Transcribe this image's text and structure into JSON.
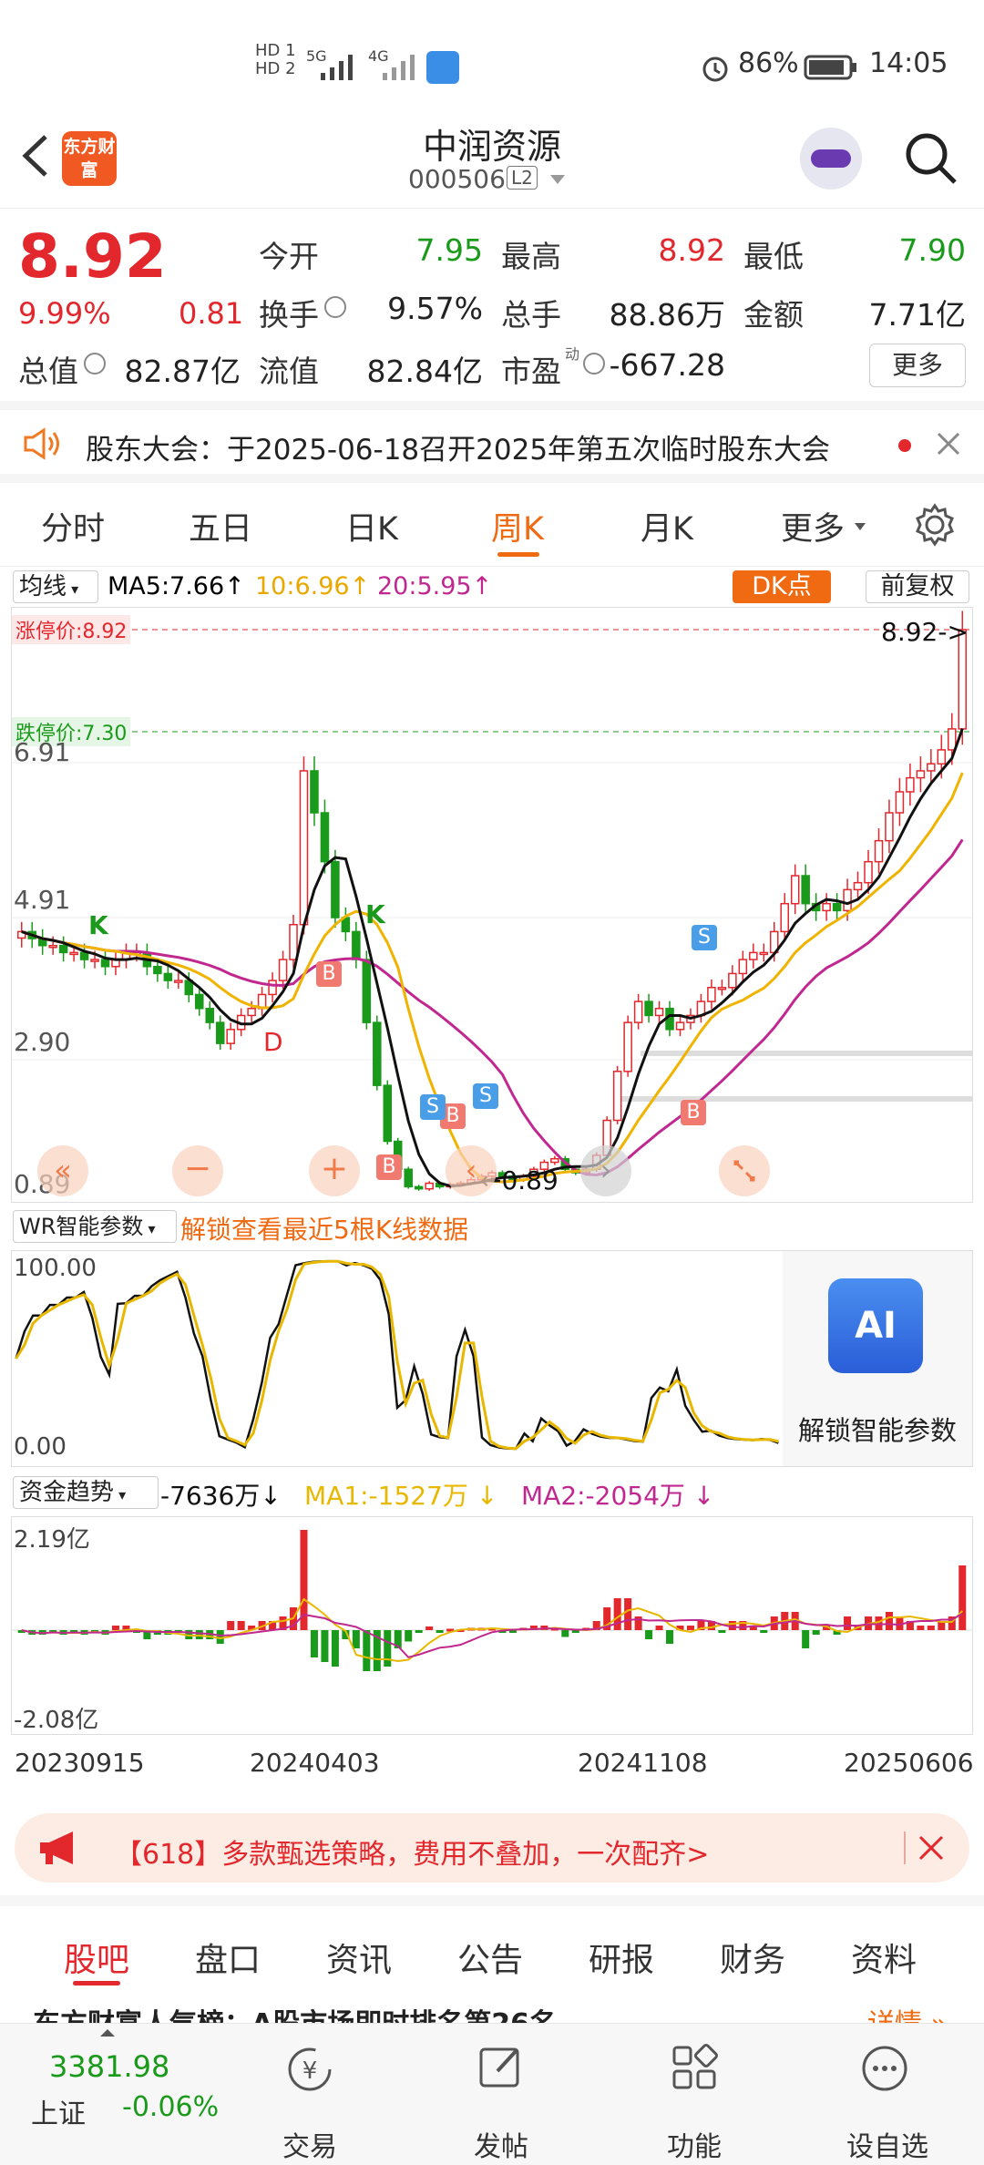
{
  "status": {
    "hd1": "HD 1",
    "hd2": "HD 2",
    "net1": "5G",
    "net2": "4G",
    "battery": "86%",
    "time": "14:05"
  },
  "nav": {
    "logo": "东方财富",
    "title": "中润资源",
    "code": "000506",
    "level": "L2"
  },
  "quote": {
    "price": "8.92",
    "pct": "9.99%",
    "chg": "0.81",
    "l_open": "今开",
    "v_open": "7.95",
    "l_high": "最高",
    "v_high": "8.92",
    "l_low": "最低",
    "v_low": "7.90",
    "l_turn": "换手",
    "v_turn": "9.57%",
    "l_vol": "总手",
    "v_vol": "88.86万",
    "l_amt": "金额",
    "v_amt": "7.71亿",
    "l_mcap": "总值",
    "v_mcap": "82.87亿",
    "l_float": "流值",
    "v_float": "82.84亿",
    "l_pe": "市盈",
    "pe_sup": "动",
    "v_pe": "-667.28",
    "more": "更多"
  },
  "notice": {
    "text": "股东大会：于2025-06-18召开2025年第五次临时股东大会"
  },
  "tabs": [
    "分时",
    "五日",
    "日K",
    "周K",
    "月K",
    "更多"
  ],
  "indicator": {
    "type": "均线",
    "ma5": "MA5:7.66",
    "ma10": "10:6.96",
    "ma20": "20:5.95",
    "dk": "DK点",
    "adjust": "前复权"
  },
  "chart": {
    "limit_up": "涨停价:8.92",
    "limit_down": "跌停价:7.30",
    "y_top": "8.92",
    "y_1": "6.91",
    "y_2": "4.91",
    "y_3": "2.90",
    "y_4": "0.89",
    "last_label": "8.92->",
    "low_label": "0.89",
    "markers": {
      "k1": "K",
      "k2": "K",
      "d": "D",
      "b": "B",
      "s": "S"
    },
    "closes": [
      4.6,
      4.5,
      4.4,
      4.4,
      4.3,
      4.3,
      4.2,
      4.2,
      4.1,
      4.2,
      4.3,
      4.3,
      4.1,
      4.0,
      3.9,
      3.9,
      3.7,
      3.5,
      3.3,
      3.0,
      3.2,
      3.4,
      3.5,
      3.7,
      3.9,
      4.2,
      4.7,
      6.9,
      6.3,
      5.6,
      4.8,
      4.6,
      4.2,
      3.3,
      2.4,
      1.6,
      1.2,
      0.95,
      0.92,
      1.0,
      0.95,
      0.98,
      1.0,
      1.05,
      1.1,
      1.15,
      1.1,
      1.05,
      1.1,
      1.2,
      1.3,
      1.35,
      1.2,
      1.15,
      1.2,
      1.4,
      1.9,
      2.6,
      3.3,
      3.6,
      3.4,
      3.5,
      3.2,
      3.3,
      3.4,
      3.6,
      3.8,
      3.8,
      4.0,
      4.2,
      4.3,
      4.3,
      4.6,
      5.0,
      5.4,
      5.0,
      4.9,
      5.0,
      4.9,
      5.2,
      5.3,
      5.6,
      5.9,
      6.3,
      6.6,
      6.8,
      6.9,
      7.0,
      7.2,
      7.5,
      8.92
    ]
  },
  "wr": {
    "label": "WR智能参数",
    "unlock": "解锁查看最近5根K线数据",
    "top": "100.00",
    "bottom": "0.00",
    "ai_label": "解锁智能参数",
    "ai_text": "AI"
  },
  "fund": {
    "label": "资金趋势",
    "value": "-7636万",
    "ma1": "MA1:-1527万",
    "ma2": "MA2:-2054万",
    "top": "2.19亿",
    "bottom": "-2.08亿"
  },
  "dates": [
    "20230915",
    "20240403",
    "20241108",
    "20250606"
  ],
  "banner": {
    "text": "【618】多款甄选策略，费用不叠加，一次配齐>"
  },
  "subtabs": [
    "股吧",
    "盘口",
    "资讯",
    "公告",
    "研报",
    "财务",
    "资料"
  ],
  "teaser": {
    "text": "东方财富人气榜：A股市场即时排名第26名",
    "link": "详情"
  },
  "bottom": {
    "index_value": "3381.98",
    "index_name": "上证",
    "index_pct": "-0.06%",
    "trade": "交易",
    "post": "发帖",
    "func": "功能",
    "watch": "设自选"
  },
  "colors": {
    "red": "#e2272d",
    "green": "#1a9a1a",
    "orange": "#ff6a00",
    "ma5": "#000000",
    "ma10": "#f0b400",
    "ma20": "#c02890"
  }
}
